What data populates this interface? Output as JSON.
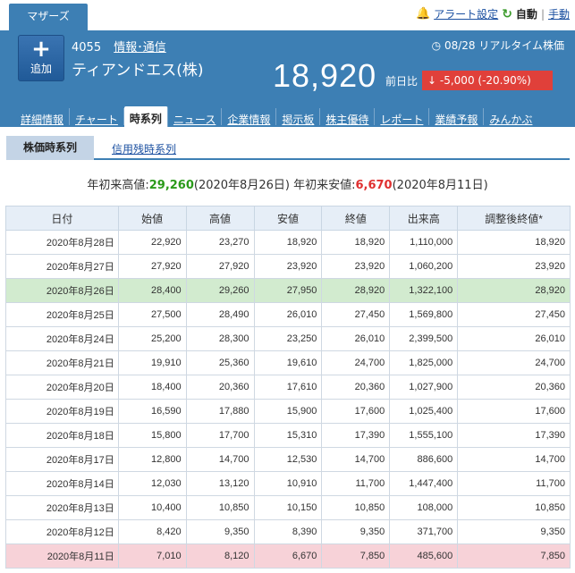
{
  "topbar": {
    "market": "マザーズ",
    "alert_label": "アラート設定",
    "auto_label": "自動",
    "manual_label": "手動"
  },
  "header": {
    "add_label": "追加",
    "code": "4055",
    "industry": "情報･通信",
    "company": "ティアンドエス(株)",
    "realtime": "08/28 リアルタイム株価",
    "price": "18,920",
    "prev_label": "前日比",
    "change": "-5,000 (-20.90%)"
  },
  "nav": [
    "詳細情報",
    "チャート",
    "時系列",
    "ニュース",
    "企業情報",
    "掲示板",
    "株主優待",
    "レポート",
    "業績予報",
    "みんかぶ"
  ],
  "subtabs": {
    "active": "株価時系列",
    "other": "信用残時系列"
  },
  "summary": {
    "high_label": "年初来高値:",
    "high_value": "29,260",
    "high_date": "(2020年8月26日)",
    "low_label": "年初来安値:",
    "low_value": "6,670",
    "low_date": "(2020年8月11日)"
  },
  "table": {
    "headers": [
      "日付",
      "始値",
      "高値",
      "安値",
      "終値",
      "出来高",
      "調整後終値*"
    ],
    "rows": [
      [
        "2020年8月28日",
        "22,920",
        "23,270",
        "18,920",
        "18,920",
        "1,110,000",
        "18,920"
      ],
      [
        "2020年8月27日",
        "27,920",
        "27,920",
        "23,920",
        "23,920",
        "1,060,200",
        "23,920"
      ],
      [
        "2020年8月26日",
        "28,400",
        "29,260",
        "27,950",
        "28,920",
        "1,322,100",
        "28,920"
      ],
      [
        "2020年8月25日",
        "27,500",
        "28,490",
        "26,010",
        "27,450",
        "1,569,800",
        "27,450"
      ],
      [
        "2020年8月24日",
        "25,200",
        "28,300",
        "23,250",
        "26,010",
        "2,399,500",
        "26,010"
      ],
      [
        "2020年8月21日",
        "19,910",
        "25,360",
        "19,610",
        "24,700",
        "1,825,000",
        "24,700"
      ],
      [
        "2020年8月20日",
        "18,400",
        "20,360",
        "17,610",
        "20,360",
        "1,027,900",
        "20,360"
      ],
      [
        "2020年8月19日",
        "16,590",
        "17,880",
        "15,900",
        "17,600",
        "1,025,400",
        "17,600"
      ],
      [
        "2020年8月18日",
        "15,800",
        "17,700",
        "15,310",
        "17,390",
        "1,555,100",
        "17,390"
      ],
      [
        "2020年8月17日",
        "12,800",
        "14,700",
        "12,530",
        "14,700",
        "886,600",
        "14,700"
      ],
      [
        "2020年8月14日",
        "12,030",
        "13,120",
        "10,910",
        "11,700",
        "1,447,400",
        "11,700"
      ],
      [
        "2020年8月13日",
        "10,400",
        "10,850",
        "10,150",
        "10,850",
        "108,000",
        "10,850"
      ],
      [
        "2020年8月12日",
        "8,420",
        "9,350",
        "8,390",
        "9,350",
        "371,700",
        "9,350"
      ],
      [
        "2020年8月11日",
        "7,010",
        "8,120",
        "6,670",
        "7,850",
        "485,600",
        "7,850"
      ]
    ],
    "highlight_green_row": 2,
    "highlight_red_row": 13
  },
  "colors": {
    "header_blue": "#3d7fb4",
    "change_red": "#e0403a",
    "high_green": "#2a9a1a",
    "low_red": "#e03030",
    "row_green": "#d2ebcf",
    "row_pink": "#f7d2d8"
  }
}
